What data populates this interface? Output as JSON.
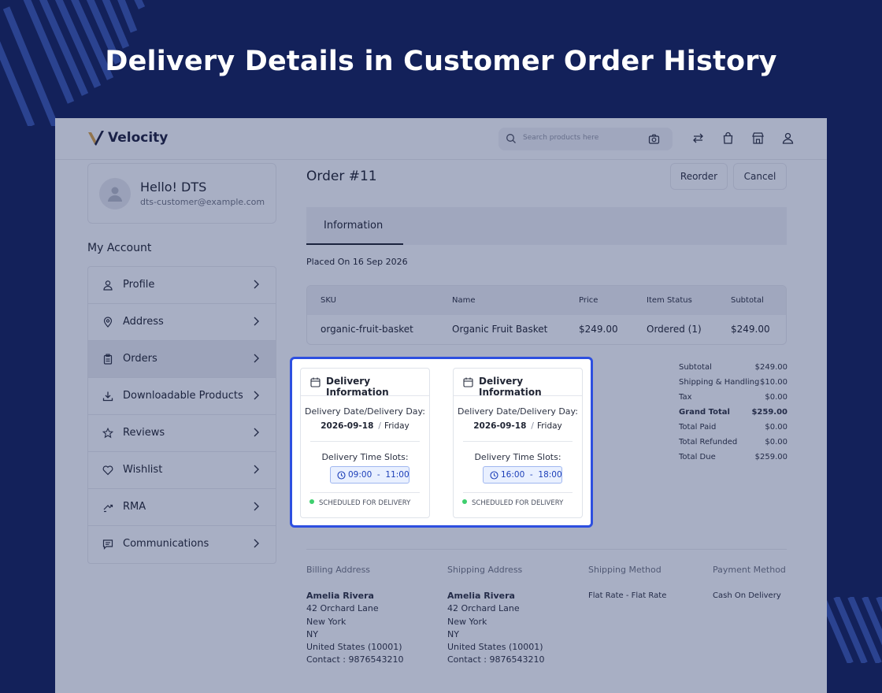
{
  "hero": {
    "title": "Delivery Details in Customer Order History"
  },
  "header": {
    "brand": "Velocity",
    "search_placeholder": "Search products here",
    "icons": [
      "compare-icon",
      "bag-icon",
      "store-icon",
      "account-icon"
    ]
  },
  "account": {
    "greeting": "Hello! DTS",
    "email": "dts-customer@example.com",
    "section_title": "My Account",
    "menu": [
      {
        "label": "Profile",
        "icon": "user-icon"
      },
      {
        "label": "Address",
        "icon": "location-pin-icon"
      },
      {
        "label": "Orders",
        "icon": "clipboard-icon"
      },
      {
        "label": "Downloadable Products",
        "icon": "download-icon"
      },
      {
        "label": "Reviews",
        "icon": "star-icon"
      },
      {
        "label": "Wishlist",
        "icon": "heart-icon"
      },
      {
        "label": "RMA",
        "icon": "return-arrows-icon"
      },
      {
        "label": "Communications",
        "icon": "chat-icon"
      }
    ],
    "active_item": "Orders"
  },
  "order": {
    "title": "Order #11",
    "reorder_label": "Reorder",
    "cancel_label": "Cancel",
    "tab": "Information",
    "placed_on": "Placed On 16 Sep 2026",
    "table": {
      "headers": [
        "SKU",
        "Name",
        "Price",
        "Item Status",
        "Subtotal"
      ],
      "row": [
        "organic-fruit-basket",
        "Organic Fruit Basket",
        "$249.00",
        "Ordered (1)",
        "$249.00"
      ]
    },
    "totals": [
      {
        "label": "Subtotal",
        "value": "$249.00"
      },
      {
        "label": "Shipping & Handling",
        "value": "$10.00"
      },
      {
        "label": "Tax",
        "value": "$0.00"
      },
      {
        "label": "Grand Total",
        "value": "$259.00"
      },
      {
        "label": "Total Paid",
        "value": "$0.00"
      },
      {
        "label": "Total Refunded",
        "value": "$0.00"
      },
      {
        "label": "Total Due",
        "value": "$259.00"
      }
    ],
    "billing": {
      "heading": "Billing Address",
      "name": "Amelia Rivera",
      "street": "42 Orchard Lane",
      "city": "New York",
      "state": "NY",
      "country": "United States (10001)",
      "contact": "Contact : 9876543210"
    },
    "shipping": {
      "heading": "Shipping Address",
      "name": "Amelia Rivera",
      "street": "42 Orchard Lane",
      "city": "New York",
      "state": "NY",
      "country": "United States (10001)",
      "contact": "Contact : 9876543210"
    },
    "shipping_method": {
      "heading": "Shipping Method",
      "value": "Flat Rate - Flat Rate"
    },
    "payment_method": {
      "heading": "Payment Method",
      "value": "Cash On Delivery"
    }
  },
  "delivery": {
    "cards": [
      {
        "title": "Delivery Information",
        "date_label": "Delivery Date/Delivery Day:",
        "date": "2026-09-18",
        "sep": "/",
        "day": "Friday",
        "slots_label": "Delivery Time Slots:",
        "slot": "09:00  -  11:00",
        "status": "SCHEDULED FOR DELIVERY"
      },
      {
        "title": "Delivery Information",
        "date_label": "Delivery Date/Delivery Day:",
        "date": "2026-09-18",
        "sep": "/",
        "day": "Friday",
        "slots_label": "Delivery Time Slots:",
        "slot": "16:00  -  18:00",
        "status": "SCHEDULED FOR DELIVERY"
      }
    ],
    "highlight_color": "#2d4fe0",
    "status_color": "#3ecf6e"
  }
}
